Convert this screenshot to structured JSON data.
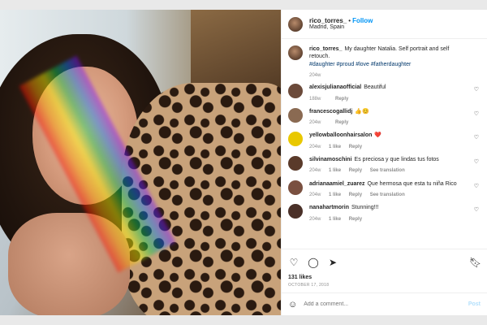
{
  "post": {
    "username": "rico_torres_",
    "follow_label": "Follow",
    "location": "Madrid, Spain",
    "caption": "My daughter Natalia. Self portrait and self retouch.",
    "hashtags": "#daughter #proud #love #fatherdaughter",
    "caption_age": "204w",
    "likes": "131 likes",
    "date": "OCTOBER 17, 2018",
    "add_comment_placeholder": "Add a comment...",
    "post_label": "Post"
  },
  "comments": [
    {
      "user": "alexisjulianaofficial",
      "text": "Beautiful",
      "age": "188w",
      "likes": "",
      "reply": "Reply",
      "see_translation": ""
    },
    {
      "user": "francescogallidj",
      "text": "👍😊",
      "age": "204w",
      "likes": "",
      "reply": "Reply",
      "see_translation": ""
    },
    {
      "user": "yellowballoonhairsalon",
      "text": "❤️",
      "age": "204w",
      "likes": "1 like",
      "reply": "Reply",
      "see_translation": ""
    },
    {
      "user": "silvinamoschini",
      "text": "Es preciosa y que lindas tus fotos",
      "age": "204w",
      "likes": "1 like",
      "reply": "Reply",
      "see_translation": "See translation"
    },
    {
      "user": "adrianaamiel_zuarez",
      "text": "Que hermosa que esta tu niña Rico",
      "age": "204w",
      "likes": "1 like",
      "reply": "Reply",
      "see_translation": "See translation"
    },
    {
      "user": "nanahartmorin",
      "text": "Stunning!!!",
      "age": "204w",
      "likes": "1 like",
      "reply": "Reply",
      "see_translation": ""
    }
  ],
  "icons": {
    "heart": "heart-icon",
    "comment": "comment-icon",
    "share": "share-icon",
    "save": "bookmark-icon",
    "emoji": "emoji-icon"
  },
  "colors": {
    "accent": "#0095f6",
    "hashtag": "#00376b",
    "muted": "#8e8e8e",
    "post_disabled": "#b2dffc"
  }
}
